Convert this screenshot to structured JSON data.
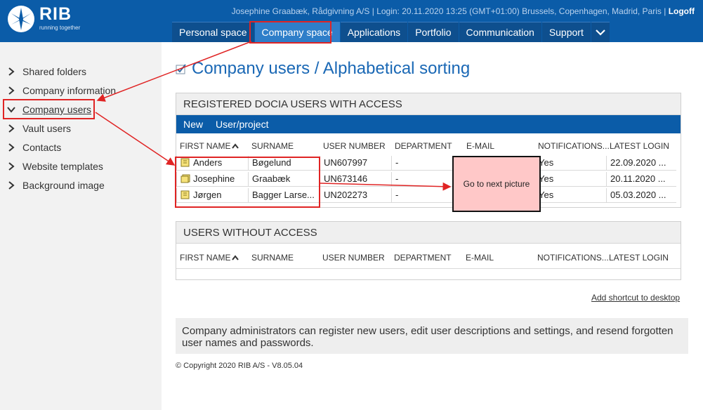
{
  "brand": {
    "name": "RIB",
    "tagline": "running together"
  },
  "userbar": {
    "user": "Josephine Graabæk, Rådgivning A/S",
    "login": "Login: 20.11.2020 13:25 (GMT+01:00) Brussels, Copenhagen, Madrid, Paris",
    "separator": "|",
    "logoff": "Logoff"
  },
  "topnav": {
    "tabs": [
      {
        "label": "Personal space"
      },
      {
        "label": "Company space"
      },
      {
        "label": "Applications"
      },
      {
        "label": "Portfolio"
      },
      {
        "label": "Communication"
      },
      {
        "label": "Support"
      }
    ],
    "active": "Company space"
  },
  "sidebar": {
    "items": [
      {
        "label": "Shared folders"
      },
      {
        "label": "Company information"
      },
      {
        "label": "Company users"
      },
      {
        "label": "Vault users"
      },
      {
        "label": "Contacts"
      },
      {
        "label": "Website templates"
      },
      {
        "label": "Background image"
      }
    ],
    "active": "Company users"
  },
  "page": {
    "title": "Company users / Alphabetical sorting"
  },
  "registered": {
    "heading": "REGISTERED DOCIA USERS WITH ACCESS",
    "toolbar": {
      "new": "New",
      "user_project": "User/project"
    },
    "columns": [
      "FIRST NAME",
      "SURNAME",
      "USER NUMBER",
      "DEPARTMENT",
      "E-MAIL",
      "NOTIFICATIONS...",
      "LATEST LOGIN"
    ],
    "rows": [
      {
        "first": "Anders",
        "surname": "Bøgelund",
        "number": "UN607997",
        "department": "-",
        "email": "",
        "notifications": "Yes",
        "login": "22.09.2020 ..."
      },
      {
        "first": "Josephine",
        "surname": "Graabæk",
        "number": "UN673146",
        "department": "-",
        "email": "",
        "notifications": "Yes",
        "login": "20.11.2020 ..."
      },
      {
        "first": "Jørgen",
        "surname": "Bagger Larse...",
        "number": "UN202273",
        "department": "-",
        "email": "",
        "notifications": "Yes",
        "login": "05.03.2020 ..."
      }
    ]
  },
  "without": {
    "heading": "USERS WITHOUT ACCESS",
    "columns": [
      "FIRST NAME",
      "SURNAME",
      "USER NUMBER",
      "DEPARTMENT",
      "E-MAIL",
      "NOTIFICATIONS...",
      "LATEST LOGIN"
    ]
  },
  "shortcut": "Add shortcut to desktop",
  "info": "Company administrators can register new users, edit user descriptions and settings, and resend forgotten user names and passwords.",
  "copyright": "© Copyright 2020 RIB A/S - V8.05.04",
  "annotation": {
    "callout": "Go to next picture",
    "color": "#e02424",
    "callout_fill": "#ffc8c8"
  },
  "colors": {
    "brand_blue": "#0b5ca8",
    "active_tab": "#2e7ec9",
    "title_blue": "#1a68b5"
  }
}
